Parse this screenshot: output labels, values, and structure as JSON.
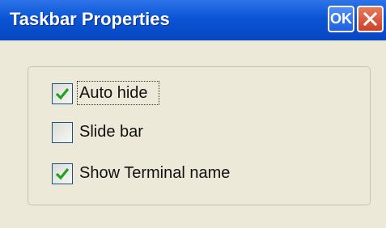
{
  "window": {
    "title": "Taskbar Properties",
    "ok_label": "OK"
  },
  "options": [
    {
      "label": "Auto hide",
      "checked": true,
      "focused": true
    },
    {
      "label": "Slide bar",
      "checked": false,
      "focused": false
    },
    {
      "label": "Show Terminal name",
      "checked": true,
      "focused": false
    }
  ],
  "colors": {
    "titlebar": "#0a55d6",
    "check": "#21a121",
    "dialog_bg": "#ece9d8"
  },
  "icons": {
    "close": "close-icon",
    "check": "checkmark-icon"
  }
}
